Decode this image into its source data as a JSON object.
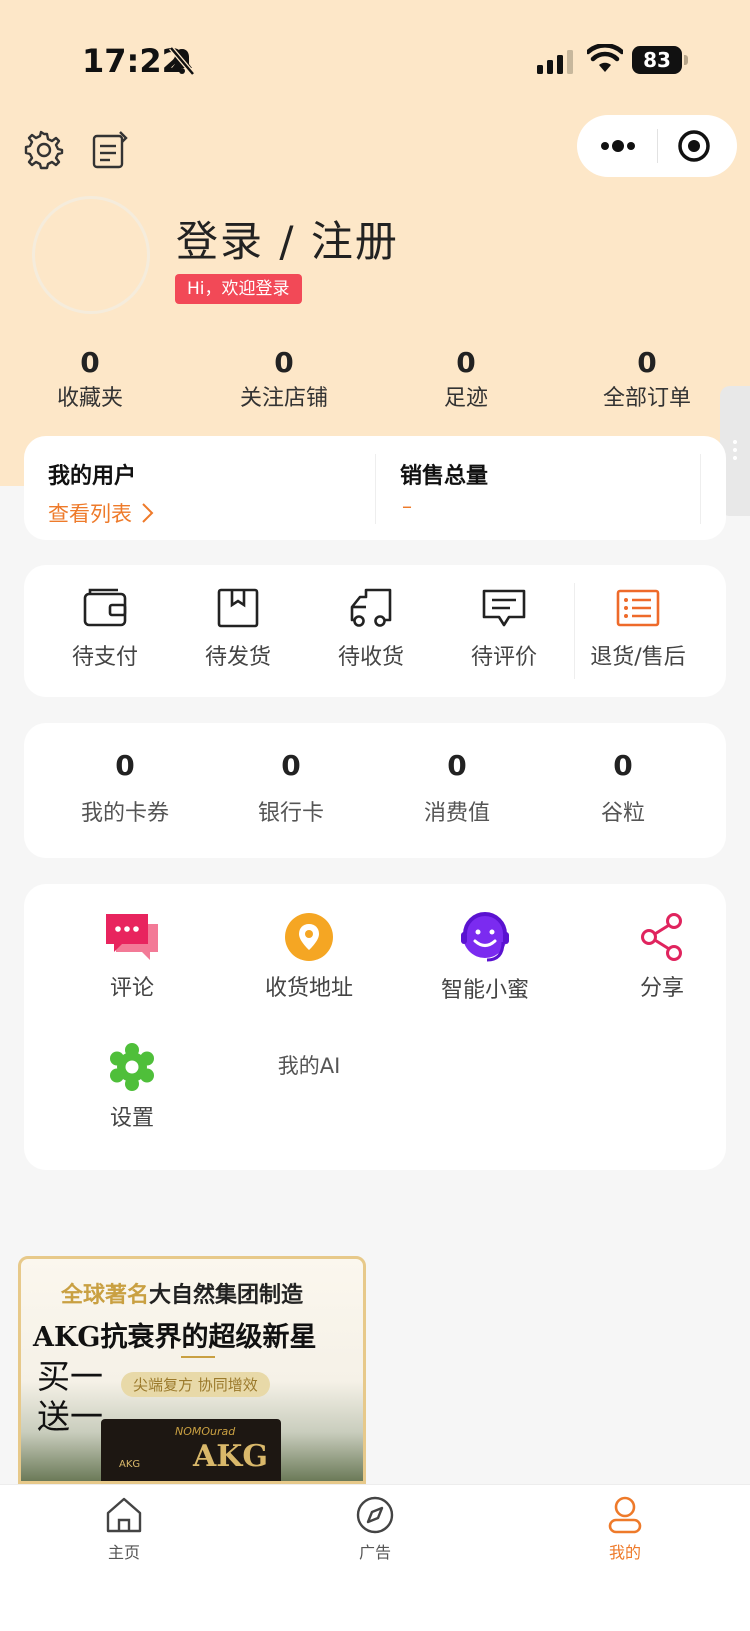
{
  "status_bar": {
    "time": "17:22",
    "battery": "83"
  },
  "profile": {
    "login_title": "登录 / 注册",
    "welcome_badge": "Hi，欢迎登录"
  },
  "top_stats": [
    {
      "value": "0",
      "label": "收藏夹"
    },
    {
      "value": "0",
      "label": "关注店铺"
    },
    {
      "value": "0",
      "label": "足迹"
    },
    {
      "value": "0",
      "label": "全部订单"
    }
  ],
  "users_card": {
    "title": "我的用户",
    "link": "查看列表",
    "sales_title": "销售总量",
    "sales_value": "–"
  },
  "orders": [
    {
      "label": "待支付",
      "icon": "wallet-icon"
    },
    {
      "label": "待发货",
      "icon": "package-icon"
    },
    {
      "label": "待收货",
      "icon": "truck-icon"
    },
    {
      "label": "待评价",
      "icon": "comment-icon"
    },
    {
      "label": "退货/售后",
      "icon": "after-sales-icon"
    }
  ],
  "assets": [
    {
      "value": "0",
      "label": "我的卡券"
    },
    {
      "value": "0",
      "label": "银行卡"
    },
    {
      "value": "0",
      "label": "消费值"
    },
    {
      "value": "0",
      "label": "谷粒"
    }
  ],
  "services": [
    {
      "label": "评论",
      "icon": "chat-bubbles-icon"
    },
    {
      "label": "收货地址",
      "icon": "location-pin-icon"
    },
    {
      "label": "智能小蜜",
      "icon": "smiley-headset-icon"
    },
    {
      "label": "分享",
      "icon": "share-icon"
    },
    {
      "label": "设置",
      "icon": "gear-flower-icon"
    }
  ],
  "my_ai": "我的AI",
  "ad": {
    "line1_gold": "全球著名",
    "line1_dark": "大自然集团制造",
    "line2": "AKG抗衰界的超级新星",
    "line3": "买一 送一",
    "pill": "尖端复方 协同增效",
    "box_brand": "NOMOurad",
    "box_name": "AKG"
  },
  "tabbar": [
    {
      "label": "主页",
      "icon": "home-icon"
    },
    {
      "label": "广告",
      "icon": "compass-icon"
    },
    {
      "label": "我的",
      "icon": "user-icon"
    }
  ],
  "colors": {
    "accent": "#ee7a2a",
    "header_bg": "#fde7c8",
    "badge": "#f24957"
  }
}
